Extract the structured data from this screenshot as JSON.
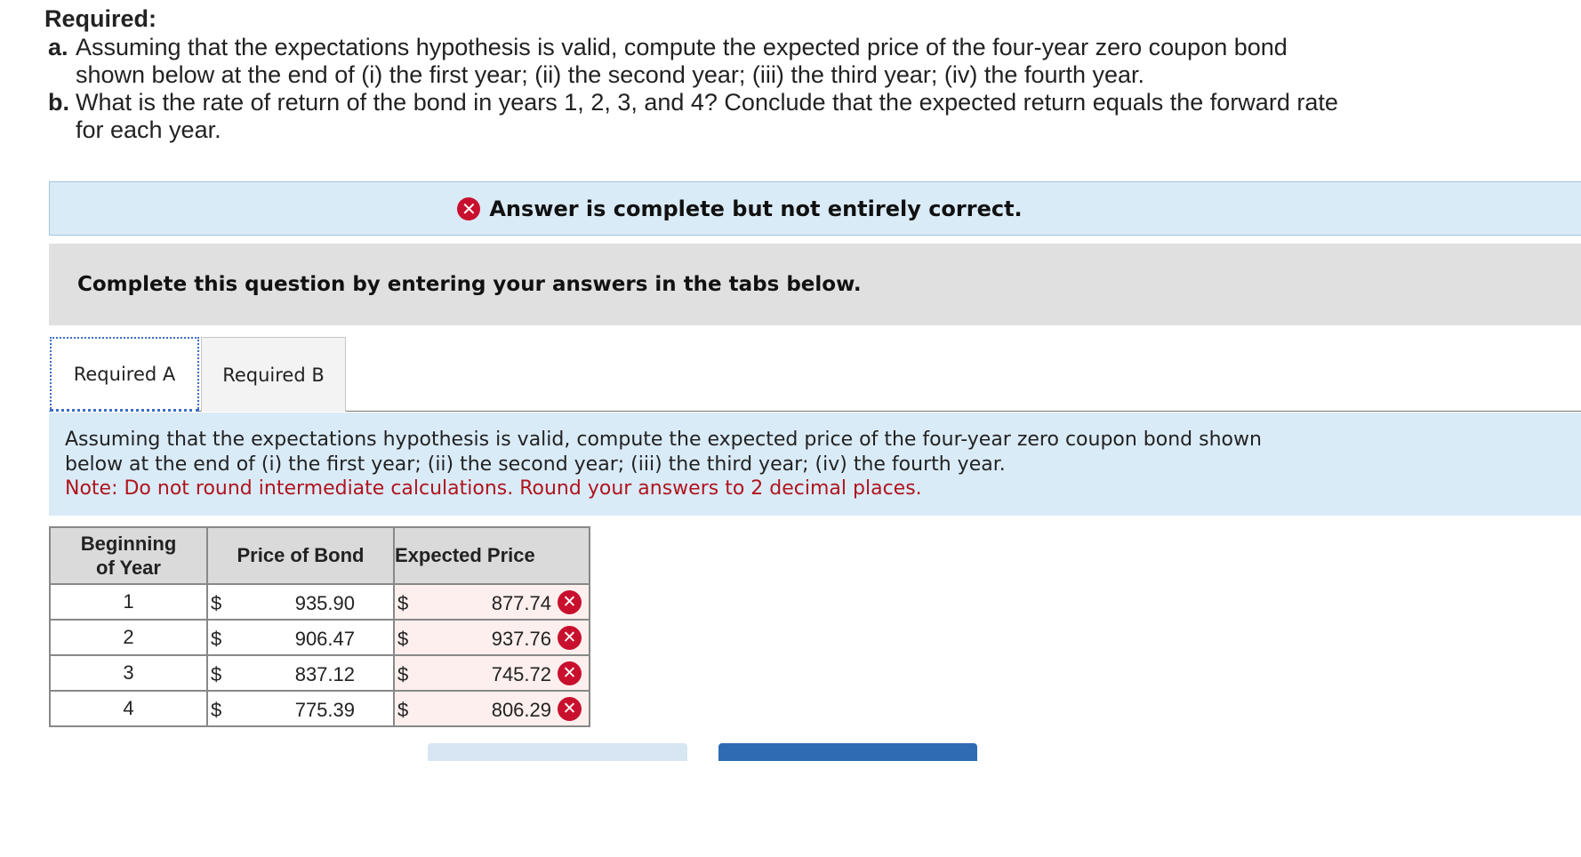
{
  "required": {
    "title": "Required:",
    "a": {
      "letter": "a.",
      "line1": "Assuming that the expectations hypothesis is valid, compute the expected price of the four-year zero coupon bond",
      "line2": "shown below at the end of (i) the first year; (ii) the second year; (iii) the third year; (iv) the fourth year."
    },
    "b": {
      "letter": "b.",
      "line1": "What is the rate of return of the bond in years 1, 2, 3, and 4? Conclude that the expected return equals the forward rate",
      "line2": "for each year."
    }
  },
  "banner": {
    "icon": "x-circle-icon",
    "message": "Answer is complete but not entirely correct."
  },
  "instructions": "Complete this question by entering your answers in the tabs below.",
  "tabs": [
    {
      "label": "Required A",
      "active": true
    },
    {
      "label": "Required B",
      "active": false
    }
  ],
  "question": {
    "line1": "Assuming that the expectations hypothesis is valid, compute the expected price of the four-year zero coupon bond shown",
    "line2": "below at the end of (i) the first year; (ii) the second year; (iii) the third year; (iv) the fourth year.",
    "note": "Note: Do not round intermediate calculations. Round your answers to 2 decimal places."
  },
  "table": {
    "headers": {
      "year_line1": "Beginning",
      "year_line2": "of Year",
      "price": "Price of Bond",
      "expected": "Expected Price"
    },
    "rows": [
      {
        "year": "1",
        "price_currency": "$",
        "price": "935.90",
        "expected_currency": "$",
        "expected": "877.74",
        "status": "incorrect"
      },
      {
        "year": "2",
        "price_currency": "$",
        "price": "906.47",
        "expected_currency": "$",
        "expected": "937.76",
        "status": "incorrect"
      },
      {
        "year": "3",
        "price_currency": "$",
        "price": "837.12",
        "expected_currency": "$",
        "expected": "745.72",
        "status": "incorrect"
      },
      {
        "year": "4",
        "price_currency": "$",
        "price": "775.39",
        "expected_currency": "$",
        "expected": "806.29",
        "status": "incorrect"
      }
    ]
  },
  "colors": {
    "incorrect": "#c8102e",
    "banner_bg": "#daebf8",
    "note": "#b0141d",
    "next_button": "#2f6bb3"
  }
}
